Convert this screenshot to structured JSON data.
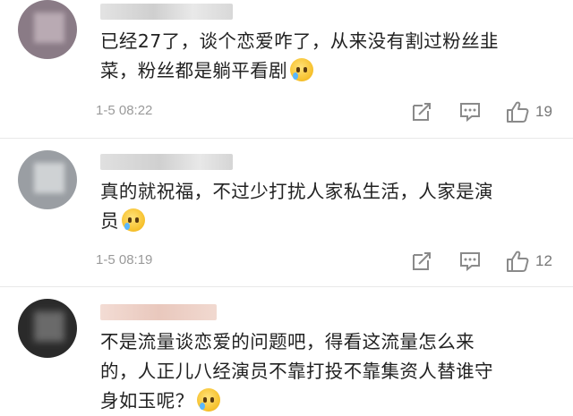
{
  "comments": [
    {
      "username_badge": "",
      "text_line1": "已经27了，谈个恋爱咋了，从来没有割过粉丝韭",
      "text_line2": "菜，粉丝都是躺平看剧",
      "time": "1-5 08:22",
      "likes": "19",
      "avatar_color": "#7b6a78"
    },
    {
      "username_badge": "",
      "text_line1": "真的就祝福，不过少打扰人家私生活，人家是演",
      "text_line2": "员",
      "time": "1-5 08:19",
      "likes": "12",
      "avatar_color": "#8c8f94"
    },
    {
      "username_badge": "",
      "text_line1": "不是流量谈恋爱的问题吧，得看这流量怎么来",
      "text_line2": "的，人正儿八经演员不靠打投不靠集资人替谁守",
      "text_line3": "身如玉呢？",
      "avatar_color": "#2b2b2b"
    }
  ],
  "icons": {
    "forward": "share-icon",
    "comment": "comment-icon",
    "like": "thumbs-up-icon",
    "emoji": "crying-emoji-icon"
  }
}
